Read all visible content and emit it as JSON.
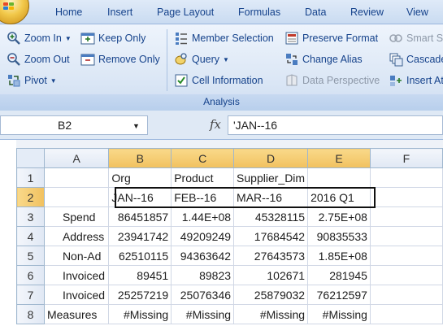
{
  "tabs": [
    "Home",
    "Insert",
    "Page Layout",
    "Formulas",
    "Data",
    "Review",
    "View"
  ],
  "ribbon": {
    "zoom_in": "Zoom In",
    "zoom_out": "Zoom Out",
    "pivot": "Pivot",
    "keep_only": "Keep Only",
    "remove_only": "Remove Only",
    "member_selection": "Member Selection",
    "query": "Query",
    "cell_information": "Cell Information",
    "preserve_format": "Preserve Format",
    "change_alias": "Change Alias",
    "data_perspective": "Data Perspective",
    "smart_slice": "Smart S",
    "cascade": "Cascade",
    "insert_attributes": "Insert At",
    "group_label": "Analysis"
  },
  "formula_bar": {
    "name_box": "B2",
    "fx": "fx",
    "formula": "'JAN--16"
  },
  "sheet": {
    "columns": [
      "A",
      "B",
      "C",
      "D",
      "E",
      "F"
    ],
    "rows": [
      {
        "num": "1",
        "cells": [
          "",
          "Org",
          "Product",
          "Supplier_Dim",
          "",
          ""
        ]
      },
      {
        "num": "2",
        "cells": [
          "",
          "JAN--16",
          "FEB--16",
          "MAR--16",
          "2016 Q1",
          ""
        ]
      },
      {
        "num": "3",
        "cells": [
          "Spend",
          "86451857",
          "1.44E+08",
          "45328115",
          "2.75E+08",
          ""
        ]
      },
      {
        "num": "4",
        "cells": [
          "Address",
          "23941742",
          "49209249",
          "17684542",
          "90835533",
          ""
        ]
      },
      {
        "num": "5",
        "cells": [
          "Non-Ad",
          "62510115",
          "94363642",
          "27643573",
          "1.85E+08",
          ""
        ]
      },
      {
        "num": "6",
        "cells": [
          "Invoiced",
          "89451",
          "89823",
          "102671",
          "281945",
          ""
        ]
      },
      {
        "num": "7",
        "cells": [
          "Invoiced",
          "25257219",
          "25076346",
          "25879032",
          "76212597",
          ""
        ]
      },
      {
        "num": "8",
        "cells": [
          "Measures",
          "#Missing",
          "#Missing",
          "#Missing",
          "#Missing",
          ""
        ]
      }
    ]
  },
  "colors": {
    "accent": "#15428b",
    "selected_header": "#f1c15f"
  }
}
